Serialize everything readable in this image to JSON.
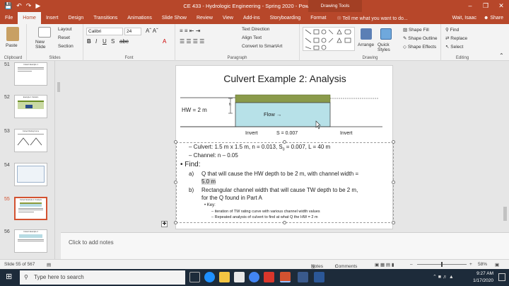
{
  "titlebar": {
    "title": "CE 433 - Hydrologic Engineering - Spring 2020 - PowerPoint",
    "context_tab": "Drawing Tools",
    "min": "–",
    "restore": "❒",
    "close": "✕"
  },
  "tabs": [
    "File",
    "Home",
    "Insert",
    "Design",
    "Transitions",
    "Animations",
    "Slide Show",
    "Review",
    "View",
    "Add-ins",
    "Storyboarding",
    "Format"
  ],
  "tell_me": "Tell me what you want to do...",
  "user": "Wait, Isaac",
  "share": "Share",
  "ribbon": {
    "clipboard": {
      "label": "Clipboard",
      "paste": "Paste"
    },
    "slides": {
      "label": "Slides",
      "new_slide": "New Slide",
      "layout": "Layout",
      "reset": "Reset",
      "section": "Section"
    },
    "font": {
      "label": "Font",
      "font_name": "Calibri",
      "font_size": "24"
    },
    "paragraph": {
      "label": "Paragraph",
      "text_direction": "Text Direction",
      "align_text": "Align Text",
      "convert_smartart": "Convert to SmartArt"
    },
    "drawing": {
      "label": "Drawing",
      "arrange": "Arrange",
      "quick_styles": "Quick Styles",
      "shape_fill": "Shape Fill",
      "shape_outline": "Shape Outline",
      "shape_effects": "Shape Effects"
    },
    "editing": {
      "label": "Editing",
      "find": "Find",
      "replace": "Replace",
      "select": "Select"
    }
  },
  "thumbnails": [
    {
      "num": "51",
      "title": "Culvert Example 1"
    },
    {
      "num": "52",
      "title": "Example 1 Solution"
    },
    {
      "num": "53",
      "title": "Culvert Rating Curve"
    },
    {
      "num": "54",
      "title": ""
    },
    {
      "num": "55",
      "title": "Culvert Example 2: Analysis"
    },
    {
      "num": "56",
      "title": "Culvert Example 2"
    }
  ],
  "slide": {
    "title": "Culvert Example 2: Analysis",
    "diagram": {
      "hw_label": "HW = 2 m",
      "flow_label": "Flow →",
      "invert_left": "Invert",
      "invert_right": "Invert",
      "slope_label": "S = 0.007",
      "depth_mark": "h"
    },
    "bullets": {
      "culvert": "Culvert: 1.5 m x 1.5 m, n = 0.013, S",
      "culvert_sub": "0",
      "culvert_rest": " = 0.007, SE = 0.007, L = 40 m",
      "channel": "Channel: n – 0.05",
      "find": "Find:",
      "a_marker": "a)",
      "a_text1": "Q that will cause the HW depth to be 2 m, with channel width =",
      "a_text2": "5.0 m",
      "b_marker": "b)",
      "b_text1": "Rectangular channel width that will cause TW depth to be 2 m,",
      "b_text2": "for the Q found in Part A",
      "key": "Key:",
      "key1": "iteration of TW rating curve with various channel width values",
      "key2": "Repeated analysis of culvert to find at what Q the HW = 2 m"
    }
  },
  "notes_placeholder": "Click to add notes",
  "status": {
    "slide": "Slide 55 of 567",
    "notes": "Notes",
    "comments": "Comments",
    "zoom": "58%"
  },
  "taskbar": {
    "search": "Type here to search",
    "time": "9:27 AM",
    "date": "1/17/2020"
  }
}
